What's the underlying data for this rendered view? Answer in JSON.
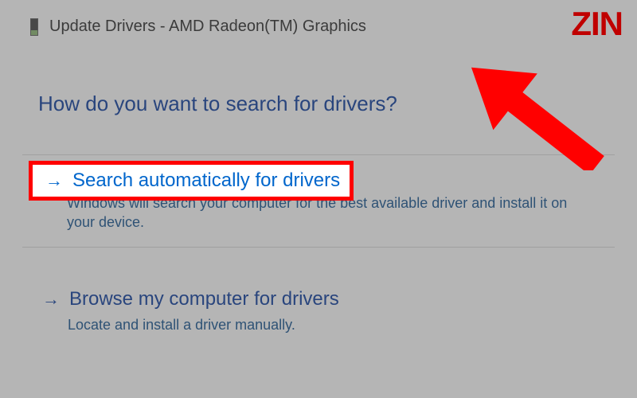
{
  "window": {
    "title": "Update Drivers - AMD Radeon(TM) Graphics"
  },
  "heading": "How do you want to search for drivers?",
  "options": [
    {
      "title": "Search automatically for drivers",
      "description": "Windows will search your computer for the best available driver and install it on your device."
    },
    {
      "title": "Browse my computer for drivers",
      "description": "Locate and install a driver manually."
    }
  ],
  "highlight": {
    "title": "Search automatically for drivers"
  },
  "brand": "ZIN",
  "annotation": {
    "arrow_color": "#ff0000"
  }
}
